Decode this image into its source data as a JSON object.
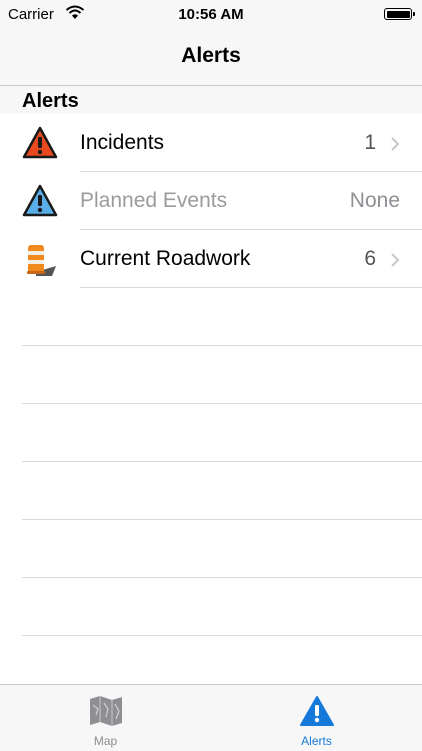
{
  "status_bar": {
    "carrier": "Carrier",
    "time": "10:56 AM"
  },
  "nav": {
    "title": "Alerts"
  },
  "section": {
    "title": "Alerts"
  },
  "rows": [
    {
      "label": "Incidents",
      "value": "1",
      "icon": "incident-warning-icon",
      "enabled": true
    },
    {
      "label": "Planned Events",
      "value": "None",
      "icon": "planned-event-warning-icon",
      "enabled": false
    },
    {
      "label": "Current Roadwork",
      "value": "6",
      "icon": "traffic-barrel-icon",
      "enabled": true
    }
  ],
  "tabs": [
    {
      "label": "Map",
      "icon": "map-icon",
      "active": false
    },
    {
      "label": "Alerts",
      "icon": "alert-icon",
      "active": true
    }
  ],
  "colors": {
    "accent": "#1479d9",
    "incident": "#e8491f",
    "planned": "#5aaee8",
    "barrel": "#f08a1e"
  }
}
